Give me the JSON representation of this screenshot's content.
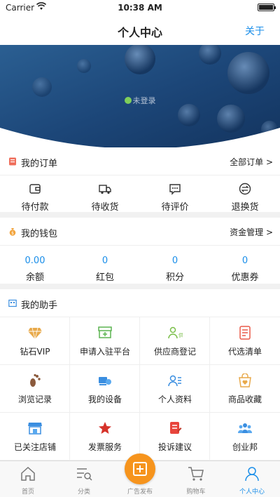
{
  "status_bar": {
    "carrier": "Carrier",
    "time": "10:38 AM"
  },
  "nav": {
    "title": "个人中心",
    "about": "关于"
  },
  "profile": {
    "login_status": "未登录"
  },
  "orders": {
    "title": "我的订单",
    "link": "全部订单 >",
    "items": [
      {
        "label": "待付款",
        "icon": "wallet-icon"
      },
      {
        "label": "待收货",
        "icon": "truck-icon"
      },
      {
        "label": "待评价",
        "icon": "comment-icon"
      },
      {
        "label": "退换货",
        "icon": "exchange-icon"
      }
    ]
  },
  "wallet": {
    "title": "我的钱包",
    "link": "资金管理 >",
    "items": [
      {
        "value": "0.00",
        "label": "余额"
      },
      {
        "value": "0",
        "label": "红包"
      },
      {
        "value": "0",
        "label": "积分"
      },
      {
        "value": "0",
        "label": "优惠券"
      }
    ]
  },
  "assistant": {
    "title": "我的助手",
    "items": [
      {
        "label": "钻石VIP",
        "icon": "diamond-icon"
      },
      {
        "label": "申请入驻平台",
        "icon": "store-add-icon"
      },
      {
        "label": "供应商登记",
        "icon": "supplier-icon"
      },
      {
        "label": "代选清单",
        "icon": "list-icon"
      },
      {
        "label": "浏览记录",
        "icon": "footprint-icon"
      },
      {
        "label": "我的设备",
        "icon": "device-icon"
      },
      {
        "label": "个人资料",
        "icon": "profile-card-icon"
      },
      {
        "label": "商品收藏",
        "icon": "favorite-bag-icon"
      },
      {
        "label": "已关注店铺",
        "icon": "shop-icon"
      },
      {
        "label": "发票服务",
        "icon": "invoice-star-icon"
      },
      {
        "label": "投诉建议",
        "icon": "complaint-icon"
      },
      {
        "label": "创业邦",
        "icon": "team-icon"
      }
    ]
  },
  "tab_bar": {
    "items": [
      {
        "label": "首页",
        "icon": "home-icon"
      },
      {
        "label": "分类",
        "icon": "category-icon"
      },
      {
        "label": "广告发布",
        "icon": "publish-icon"
      },
      {
        "label": "购物车",
        "icon": "cart-icon"
      },
      {
        "label": "个人中心",
        "icon": "user-icon"
      }
    ]
  },
  "colors": {
    "accent": "#1a8ee9",
    "publish": "#f6941d",
    "hero": "#1f4a7a"
  }
}
